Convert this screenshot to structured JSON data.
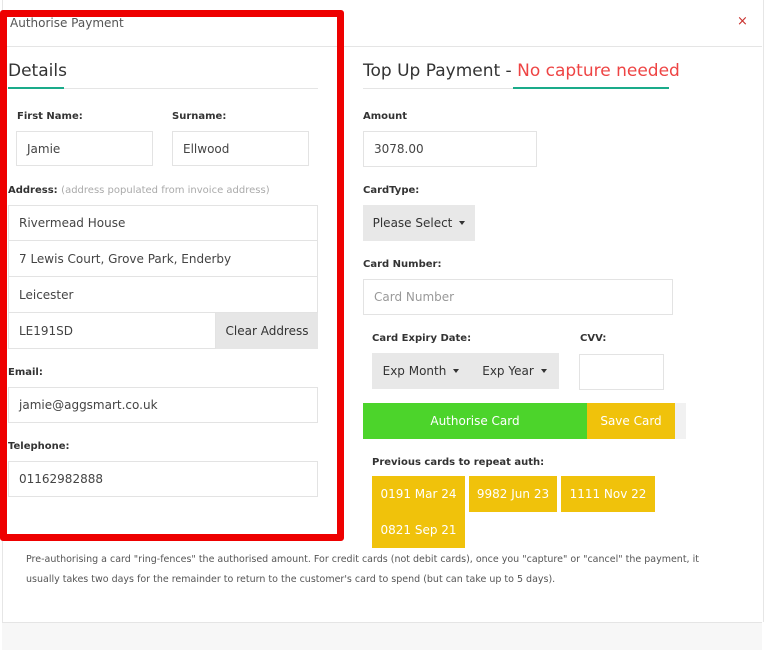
{
  "modal": {
    "title": "Authorise Payment",
    "close_label": "×"
  },
  "details": {
    "title": "Details",
    "first_name_label": "First Name:",
    "first_name_value": "Jamie",
    "surname_label": "Surname:",
    "surname_value": "Ellwood",
    "address_label": "Address:",
    "address_note": "(address populated from invoice address)",
    "address_line1": "Rivermead House",
    "address_line2": "7 Lewis Court, Grove Park, Enderby",
    "address_city": "Leicester",
    "address_postcode": "LE191SD",
    "clear_address_label": "Clear Address",
    "email_label": "Email:",
    "email_value": "jamie@aggsmart.co.uk",
    "telephone_label": "Telephone:",
    "telephone_value": "01162982888"
  },
  "topup": {
    "title_main": "Top Up Payment - ",
    "title_accent": "No capture needed",
    "amount_label": "Amount",
    "amount_value": "3078.00",
    "card_type_label": "CardType:",
    "card_type_selected": "Please Select",
    "card_number_label": "Card Number:",
    "card_number_placeholder": "Card Number",
    "expiry_label": "Card Expiry Date:",
    "exp_month_label": "Exp Month",
    "exp_year_label": "Exp Year",
    "cvv_label": "CVV:",
    "authorise_label": "Authorise Card",
    "save_label": "Save Card",
    "previous_cards_label": "Previous cards to repeat auth:",
    "previous_cards": [
      "0191 Mar 24",
      "9982 Jun 23",
      "1111 Nov 22",
      "0821 Sep 21"
    ]
  },
  "note": "Pre-authorising a card \"ring-fences\" the authorised amount. For credit cards (not debit cards), once you \"capture\" or \"cancel\" the payment, it usually takes two days for the remainder to return to the customer's card to spend (but can take up to 5 days).",
  "colors": {
    "accent_red": "#ee4444",
    "underline_green": "#1aab8a",
    "green_button": "#4cd42b",
    "yellow_button": "#f0c20b",
    "highlight_frame": "#ee0000"
  }
}
